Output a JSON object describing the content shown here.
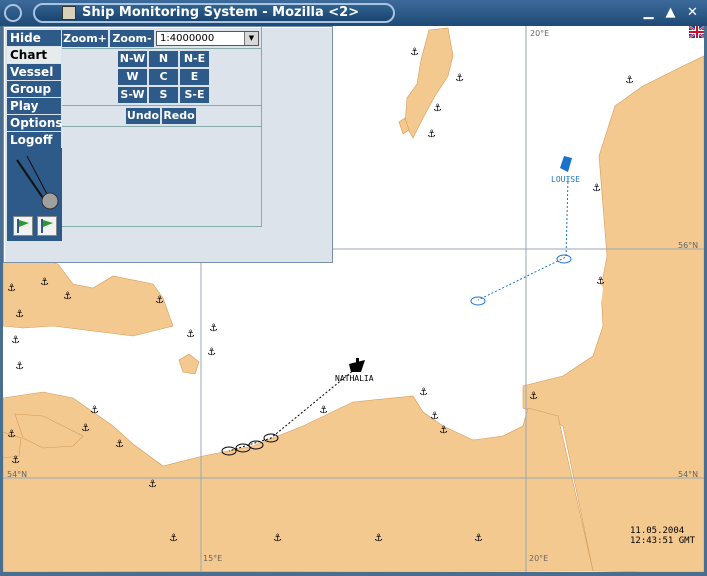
{
  "window": {
    "title": "Ship Monitoring System - Mozilla <2>",
    "minimize_icon": "minimize-icon",
    "maximize_icon": "maximize-icon",
    "close_icon": "close-icon"
  },
  "menu": {
    "items": [
      {
        "label": "Hide"
      },
      {
        "label": "Chart"
      },
      {
        "label": "Vessel"
      },
      {
        "label": "Group"
      },
      {
        "label": "Play"
      },
      {
        "label": "Options"
      },
      {
        "label": "Logoff"
      }
    ],
    "active": "Chart"
  },
  "toolbar": {
    "zoom_in_label": "Zoom+",
    "zoom_out_label": "Zoom-",
    "scale_value": "1:4000000",
    "undo_label": "Undo",
    "redo_label": "Redo"
  },
  "directions": {
    "nw": "N-W",
    "n": "N",
    "ne": "N-E",
    "w": "W",
    "c": "C",
    "e": "E",
    "sw": "S-W",
    "s": "S",
    "se": "S-E"
  },
  "map": {
    "coords": {
      "lon_20_top": "20°E",
      "lat_56_right": "56°N",
      "lat_54_left": "54°N",
      "lat_54_right": "54°N",
      "lon_15_bottom": "15°E",
      "lon_20_bottom": "20°E"
    },
    "vessels": [
      {
        "name": "LOUISE",
        "color": "#1a73c9"
      },
      {
        "name": "NATHALIA",
        "color": "#000000"
      }
    ],
    "date": "11.05.2004",
    "time": "12:43:51 GMT",
    "colors": {
      "land": "#f4c98f",
      "sea": "#ffffff",
      "grid": "#9aa6b2"
    }
  }
}
